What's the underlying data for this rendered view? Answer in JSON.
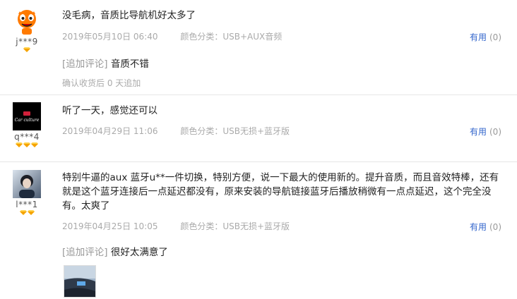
{
  "reviews": [
    {
      "user": "j***9",
      "text": "没毛病，音质比导航机好太多了",
      "date": "2019年05月10日 06:40",
      "spec": "颜色分类：USB+AUX音频",
      "useful_label": "有用",
      "useful_count": "(0)",
      "append_tag": "[追加评论]",
      "append_text": "音质不错",
      "append_time": "确认收货后 0 天追加",
      "level_icons": 1,
      "avatar_icon": "orange-mascot-avatar"
    },
    {
      "user": "q***4",
      "text": "听了一天，感觉还可以",
      "date": "2019年04月29日 11:06",
      "spec": "颜色分类：USB无损+蓝牙版",
      "useful_label": "有用",
      "useful_count": "(0)",
      "level_icons": 3,
      "avatar_icon": "car-culture-logo-avatar",
      "avatar_text": "Car culture"
    },
    {
      "user": "l***1",
      "text": "特别牛逼的aux 蓝牙u**一件切换，特别方便，说一下最大的使用新的。提升音质，而且音效特棒，还有就是这个蓝牙连接后一点延迟都没有，原来安装的导航链接蓝牙后播放稍微有一点点延迟，这个完全没有。太爽了",
      "date": "2019年04月25日 10:05",
      "spec": "颜色分类：USB无损+蓝牙版",
      "useful_label": "有用",
      "useful_count": "(0)",
      "append_tag": "[追加评论]",
      "append_text": "很好太满意了",
      "level_icons": 2,
      "avatar_icon": "photo-avatar",
      "photo_icon": "car-interior-photo-thumbnail"
    }
  ],
  "colors": {
    "link": "#3366cc",
    "meta": "#aaaaaa",
    "diamond": "#f5a300",
    "divider": "#e6e6e6"
  }
}
